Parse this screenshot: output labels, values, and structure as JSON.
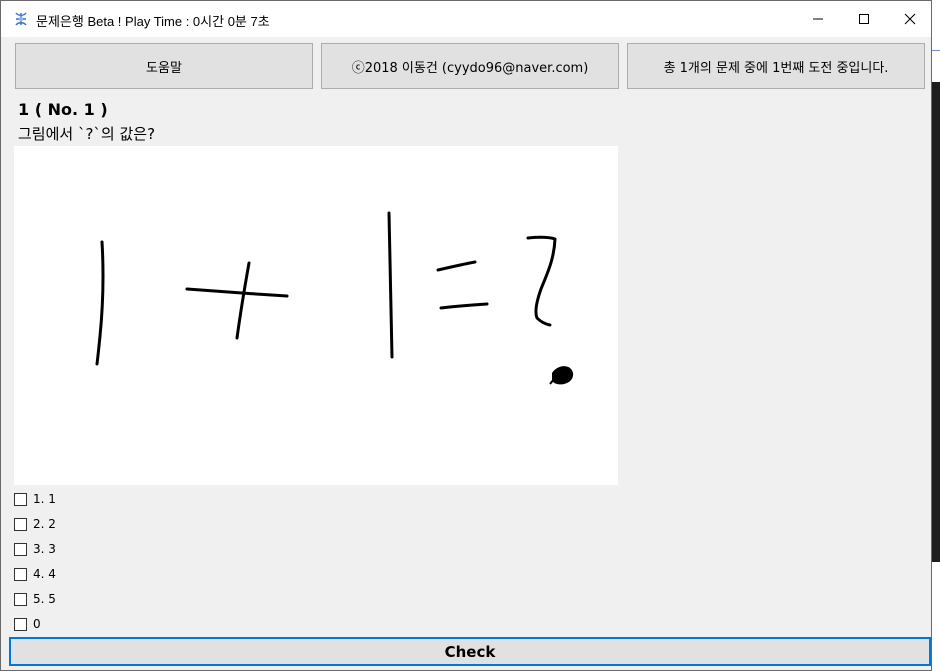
{
  "window": {
    "title": "문제은행 Beta ! Play Time : 0시간 0분 7초",
    "icon": "app-icon"
  },
  "toolbar": {
    "help_label": "도움말",
    "copyright_label": "ⓒ2018 이동건 (cyydo96@naver.com)",
    "status_label": "총 1개의 문제 중에 1번째 도전 중입니다."
  },
  "question": {
    "title": "1 ( No. 1 )",
    "text": "그림에서 `?`의 값은?"
  },
  "options": [
    {
      "label": "1. 1",
      "checked": false
    },
    {
      "label": "2. 2",
      "checked": false
    },
    {
      "label": "3. 3",
      "checked": false
    },
    {
      "label": "4. 4",
      "checked": false
    },
    {
      "label": "5. 5",
      "checked": false
    },
    {
      "label": "0",
      "checked": false
    }
  ],
  "actions": {
    "check_label": "Check"
  },
  "colors": {
    "accent": "#0078d7",
    "button_bg": "#e1e1e1",
    "window_bg": "#f0f0f0"
  }
}
